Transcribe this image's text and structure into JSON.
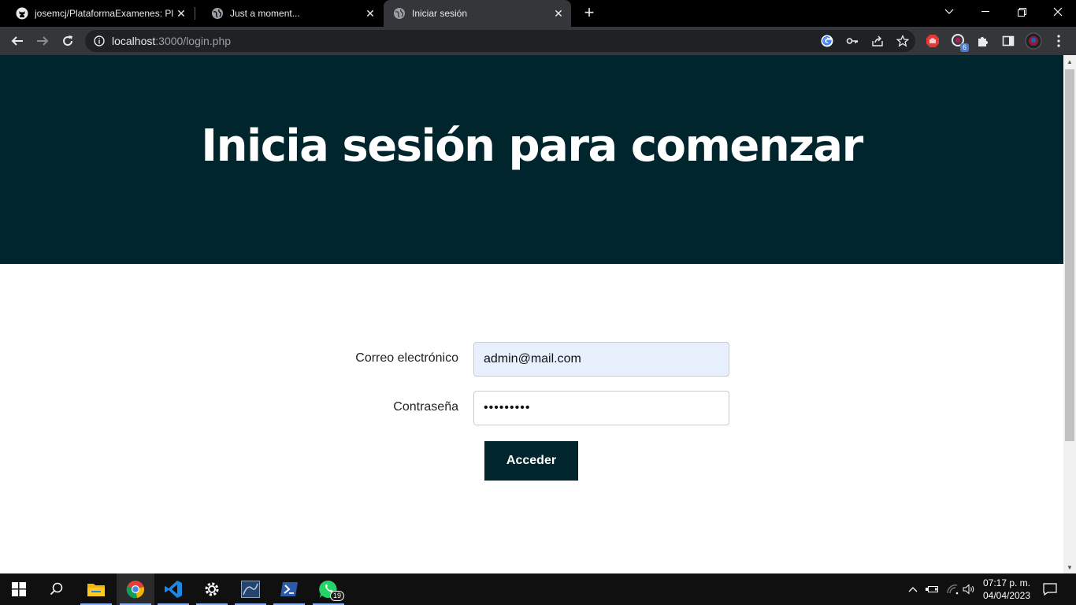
{
  "browser": {
    "tabs": [
      {
        "title": "josemcj/PlataformaExamenes: Pla",
        "favicon": "github-icon",
        "active": false
      },
      {
        "title": "Just a moment...",
        "favicon": "globe-icon",
        "active": false
      },
      {
        "title": "Iniciar sesión",
        "favicon": "globe-icon",
        "active": true
      }
    ],
    "url_host": "localhost",
    "url_rest": ":3000/login.php",
    "extension_badge": "6"
  },
  "page": {
    "heading": "Inicia sesión para comenzar",
    "email_label": "Correo electrónico",
    "email_value": "admin@mail.com",
    "password_label": "Contraseña",
    "password_value": "•••••••••",
    "submit_label": "Acceder",
    "colors": {
      "hero": "#00252c",
      "autofill": "#e8f0fe"
    }
  },
  "taskbar": {
    "apps": [
      "windows-start",
      "search",
      "file-explorer",
      "chrome",
      "vscode",
      "settings",
      "mysql-workbench",
      "powershell",
      "whatsapp"
    ],
    "whatsapp_badge": "19",
    "time": "07:17 p. m.",
    "date": "04/04/2023"
  }
}
